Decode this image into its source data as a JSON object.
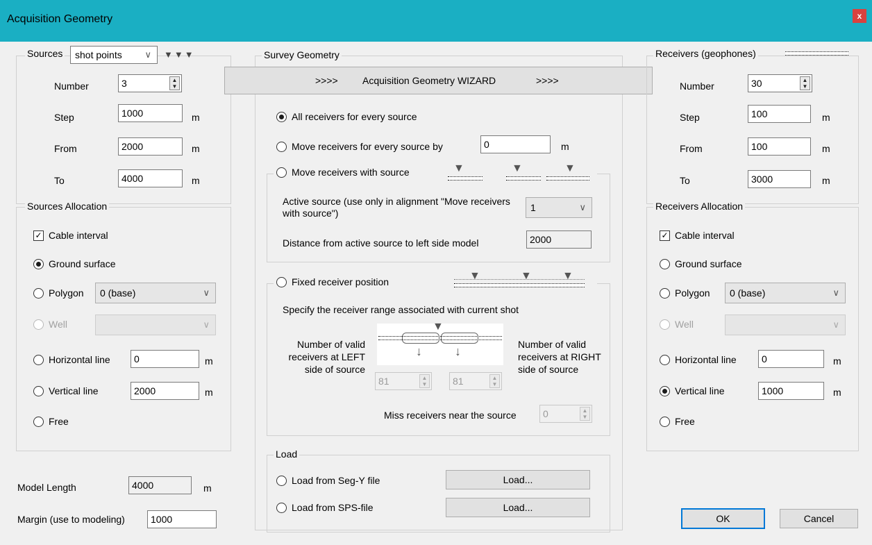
{
  "window": {
    "title": "Acquisition Geometry",
    "close_label": "x"
  },
  "sources": {
    "group_label": "Sources",
    "type_select": "shot points",
    "number_label": "Number",
    "number_value": "3",
    "step_label": "Step",
    "step_value": "1000",
    "step_unit": "m",
    "from_label": "From",
    "from_value": "2000",
    "from_unit": "m",
    "to_label": "To",
    "to_value": "4000",
    "to_unit": "m"
  },
  "sources_allocation": {
    "group_label": "Sources Allocation",
    "cable_interval": "Cable interval",
    "ground_surface": "Ground surface",
    "polygon": "Polygon",
    "polygon_value": "0 (base)",
    "well": "Well",
    "horizontal_line": "Horizontal line",
    "horizontal_value": "0",
    "horizontal_unit": "m",
    "vertical_line": "Vertical line",
    "vertical_value": "2000",
    "vertical_unit": "m",
    "free": "Free"
  },
  "model": {
    "length_label": "Model Length",
    "length_value": "4000",
    "length_unit": "m",
    "margin_label": "Margin (use to modeling)",
    "margin_value": "1000"
  },
  "survey": {
    "group_label": "Survey Geometry",
    "wizard_prefix": ">>>>",
    "wizard_label": "Acquisition Geometry WIZARD",
    "wizard_suffix": ">>>>",
    "all_receivers": "All receivers for every source",
    "move_by": "Move receivers for every source by",
    "move_by_value": "0",
    "move_by_unit": "m",
    "move_with_source": "Move receivers with source",
    "active_source_label": "Active source (use only in alignment \"Move receivers with source\")",
    "active_source_value": "1",
    "distance_label": "Distance from active source to left side model",
    "distance_value": "2000",
    "fixed": "Fixed receiver position",
    "specify_label": "Specify the receiver range associated with current shot",
    "left_label": "Number of valid receivers at LEFT side of source",
    "right_label": "Number of valid receivers at RIGHT side of source",
    "left_value": "81",
    "right_value": "81",
    "miss_label": "Miss receivers near the source",
    "miss_value": "0"
  },
  "load": {
    "group_label": "Load",
    "segy": "Load from Seg-Y file",
    "sps": "Load from SPS-file",
    "load_button": "Load..."
  },
  "receivers": {
    "group_label": "Receivers (geophones)",
    "number_label": "Number",
    "number_value": "30",
    "step_label": "Step",
    "step_value": "100",
    "step_unit": "m",
    "from_label": "From",
    "from_value": "100",
    "from_unit": "m",
    "to_label": "To",
    "to_value": "3000",
    "to_unit": "m"
  },
  "receivers_allocation": {
    "group_label": "Receivers Allocation",
    "cable_interval": "Cable interval",
    "ground_surface": "Ground surface",
    "polygon": "Polygon",
    "polygon_value": "0 (base)",
    "well": "Well",
    "horizontal_line": "Horizontal line",
    "horizontal_value": "0",
    "horizontal_unit": "m",
    "vertical_line": "Vertical line",
    "vertical_value": "1000",
    "vertical_unit": "m",
    "free": "Free"
  },
  "footer": {
    "ok": "OK",
    "cancel": "Cancel"
  },
  "colors": {
    "titlebar": "#1aafc3",
    "close": "#d9423f",
    "default_button_border": "#0078d7"
  }
}
